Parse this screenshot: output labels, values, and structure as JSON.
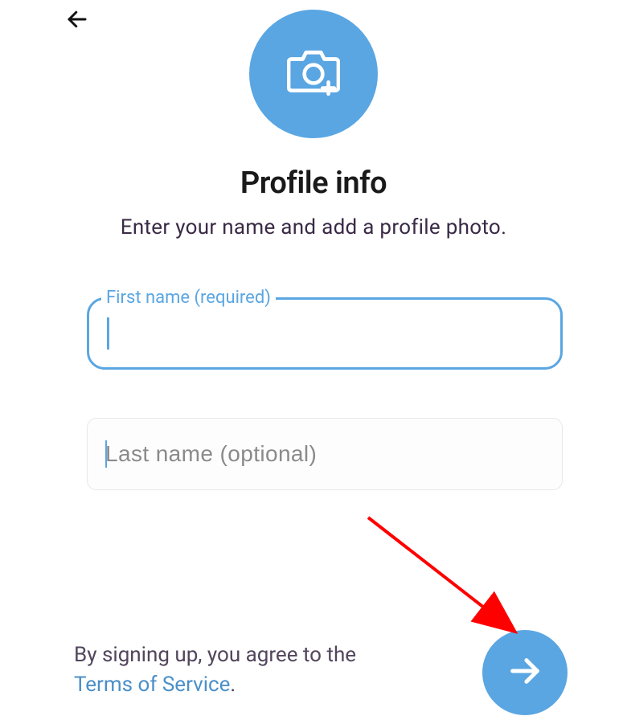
{
  "header": {
    "title": "Profile info",
    "subtitle": "Enter your name and add a profile photo."
  },
  "form": {
    "first_name": {
      "label": "First name (required)",
      "value": ""
    },
    "last_name": {
      "placeholder": "Last name (optional)",
      "value": ""
    }
  },
  "footer": {
    "prefix": "By signing up, you agree to the ",
    "link_text": "Terms of Service",
    "suffix": "."
  },
  "colors": {
    "accent": "#5aa6e2"
  },
  "icons": {
    "back": "arrow-left",
    "avatar": "camera-add",
    "fab": "arrow-right"
  }
}
